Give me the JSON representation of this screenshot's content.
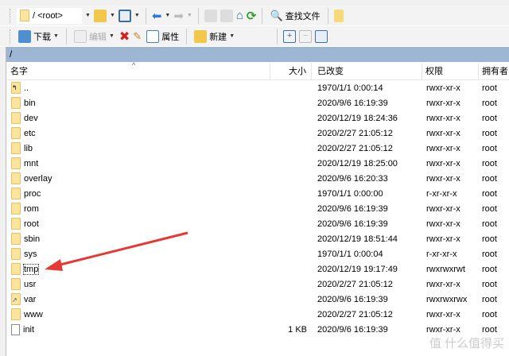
{
  "toolbar1": {
    "path_selector": "/ <root>",
    "find_files": "查找文件"
  },
  "toolbar2": {
    "download": "下载",
    "edit": "编辑",
    "properties": "属性",
    "new": "新建"
  },
  "path": "/",
  "columns": {
    "name": "名字",
    "size": "大小",
    "modified": "已改变",
    "permissions": "权限",
    "owner": "拥有者"
  },
  "files": [
    {
      "name": "..",
      "size": "",
      "modified": "1970/1/1 0:00:14",
      "permissions": "rwxr-xr-x",
      "owner": "root",
      "type": "parent"
    },
    {
      "name": "bin",
      "size": "",
      "modified": "2020/9/6 16:19:39",
      "permissions": "rwxr-xr-x",
      "owner": "root",
      "type": "folder"
    },
    {
      "name": "dev",
      "size": "",
      "modified": "2020/12/19 18:24:36",
      "permissions": "rwxr-xr-x",
      "owner": "root",
      "type": "folder"
    },
    {
      "name": "etc",
      "size": "",
      "modified": "2020/2/27 21:05:12",
      "permissions": "rwxr-xr-x",
      "owner": "root",
      "type": "folder"
    },
    {
      "name": "lib",
      "size": "",
      "modified": "2020/2/27 21:05:12",
      "permissions": "rwxr-xr-x",
      "owner": "root",
      "type": "folder"
    },
    {
      "name": "mnt",
      "size": "",
      "modified": "2020/12/19 18:25:00",
      "permissions": "rwxr-xr-x",
      "owner": "root",
      "type": "folder"
    },
    {
      "name": "overlay",
      "size": "",
      "modified": "2020/9/6 16:20:33",
      "permissions": "rwxr-xr-x",
      "owner": "root",
      "type": "folder"
    },
    {
      "name": "proc",
      "size": "",
      "modified": "1970/1/1 0:00:00",
      "permissions": "r-xr-xr-x",
      "owner": "root",
      "type": "folder"
    },
    {
      "name": "rom",
      "size": "",
      "modified": "2020/9/6 16:19:39",
      "permissions": "rwxr-xr-x",
      "owner": "root",
      "type": "folder"
    },
    {
      "name": "root",
      "size": "",
      "modified": "2020/9/6 16:19:39",
      "permissions": "rwxr-xr-x",
      "owner": "root",
      "type": "folder"
    },
    {
      "name": "sbin",
      "size": "",
      "modified": "2020/12/19 18:51:44",
      "permissions": "rwxr-xr-x",
      "owner": "root",
      "type": "folder"
    },
    {
      "name": "sys",
      "size": "",
      "modified": "1970/1/1 0:00:04",
      "permissions": "r-xr-xr-x",
      "owner": "root",
      "type": "folder"
    },
    {
      "name": "tmp",
      "size": "",
      "modified": "2020/12/19 19:17:49",
      "permissions": "rwxrwxrwt",
      "owner": "root",
      "type": "folder",
      "focused": true
    },
    {
      "name": "usr",
      "size": "",
      "modified": "2020/2/27 21:05:12",
      "permissions": "rwxr-xr-x",
      "owner": "root",
      "type": "folder"
    },
    {
      "name": "var",
      "size": "",
      "modified": "2020/9/6 16:19:39",
      "permissions": "rwxrwxrwx",
      "owner": "root",
      "type": "link"
    },
    {
      "name": "www",
      "size": "",
      "modified": "2020/2/27 21:05:12",
      "permissions": "rwxr-xr-x",
      "owner": "root",
      "type": "folder"
    },
    {
      "name": "init",
      "size": "1 KB",
      "modified": "2020/9/6 16:19:39",
      "permissions": "rwxr-xr-x",
      "owner": "root",
      "type": "file"
    }
  ],
  "watermark": "值 什么值得买",
  "colors": {
    "path_bar": "#9db6d3",
    "annotation_arrow": "#e53935"
  }
}
